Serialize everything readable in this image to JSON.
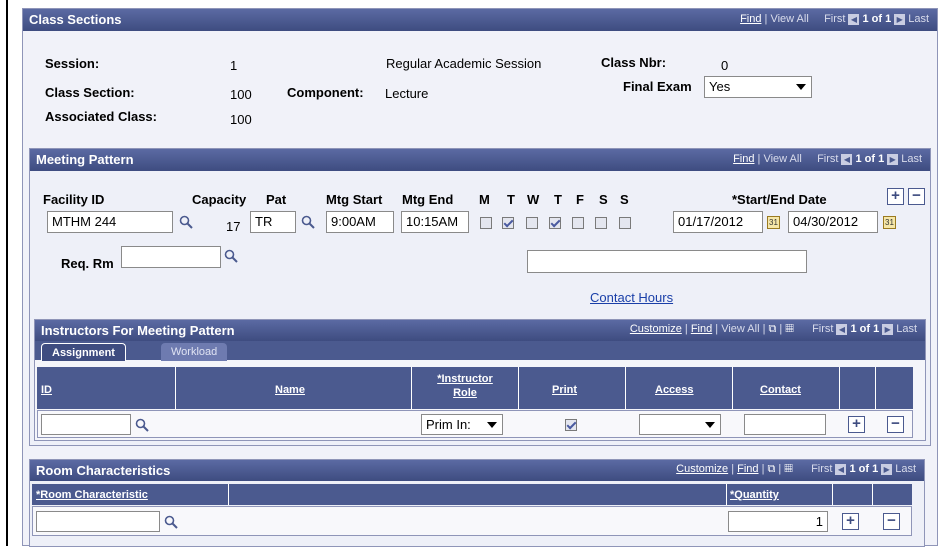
{
  "class_sections": {
    "title": "Class Sections",
    "nav": {
      "find": "Find",
      "view_all": "View All",
      "first": "First",
      "count": "1 of 1",
      "last": "Last"
    },
    "session_label": "Session:",
    "session_value": "1",
    "session_desc": "Regular Academic Session",
    "class_nbr_label": "Class Nbr:",
    "class_nbr_value": "0",
    "class_section_label": "Class Section:",
    "class_section_value": "100",
    "component_label": "Component:",
    "component_value": "Lecture",
    "final_exam_label": "Final Exam",
    "final_exam_value": "Yes",
    "associated_class_label": "Associated Class:",
    "associated_class_value": "100"
  },
  "meeting_pattern": {
    "title": "Meeting Pattern",
    "nav": {
      "find": "Find",
      "view_all": "View All",
      "first": "First",
      "count": "1 of 1",
      "last": "Last"
    },
    "facility_label": "Facility ID",
    "facility_value": "MTHM 244",
    "capacity_label": "Capacity",
    "capacity_value": "17",
    "pat_label": "Pat",
    "pat_value": "TR",
    "mtg_start_label": "Mtg Start",
    "mtg_start_value": "9:00AM",
    "mtg_end_label": "Mtg End",
    "mtg_end_value": "10:15AM",
    "days": [
      {
        "label": "M",
        "checked": false
      },
      {
        "label": "T",
        "checked": true
      },
      {
        "label": "W",
        "checked": false
      },
      {
        "label": "T",
        "checked": true
      },
      {
        "label": "F",
        "checked": false
      },
      {
        "label": "S",
        "checked": false
      },
      {
        "label": "S",
        "checked": false
      }
    ],
    "dates_label": "*Start/End Date",
    "start_date": "01/17/2012",
    "end_date": "04/30/2012",
    "req_rm_label": "Req. Rm",
    "contact_hours": "Contact Hours"
  },
  "instructors": {
    "title": "Instructors For Meeting Pattern",
    "nav": {
      "customize": "Customize",
      "find": "Find",
      "view_all": "View All",
      "first": "First",
      "count": "1 of 1",
      "last": "Last"
    },
    "tabs": [
      "Assignment",
      "Workload"
    ],
    "columns": {
      "id": "ID",
      "name": "Name",
      "role_line1": "*Instructor",
      "role_line2": "Role",
      "print": "Print",
      "access": "Access",
      "contact": "Contact"
    },
    "row": {
      "role": "Prim In:",
      "print_checked": true
    }
  },
  "room_characteristics": {
    "title": "Room Characteristics",
    "nav": {
      "customize": "Customize",
      "find": "Find",
      "first": "First",
      "count": "1 of 1",
      "last": "Last"
    },
    "columns": {
      "room_char": "*Room Characteristic",
      "quantity": "*Quantity"
    },
    "row": {
      "quantity": "1"
    }
  },
  "icons": {
    "lookup": "magnifier-icon",
    "calendar": "calendar-icon",
    "add": "plus-icon",
    "delete": "minus-icon",
    "grid": "grid-icon",
    "zoom": "zoom-icon"
  }
}
